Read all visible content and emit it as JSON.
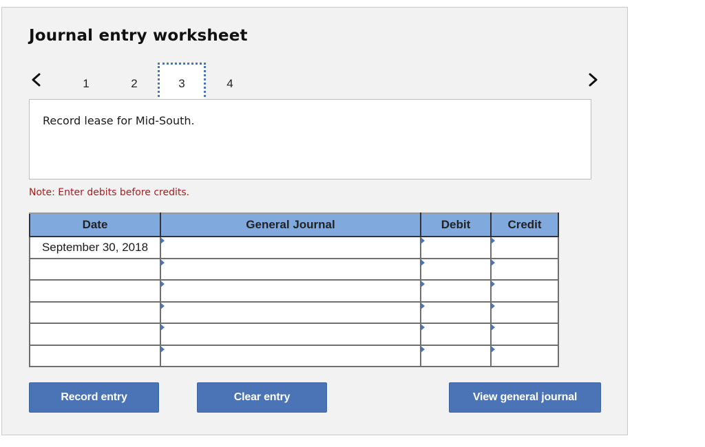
{
  "worksheet": {
    "title": "Journal entry worksheet",
    "nav": {
      "prev_icon": "chevron-left-icon",
      "next_icon": "chevron-right-icon",
      "steps": [
        "1",
        "2",
        "3",
        "4"
      ],
      "active_step": "3"
    },
    "description": "Record lease for Mid-South.",
    "note": "Note: Enter debits before credits.",
    "note_color": "#a51d1d",
    "accent_color": "#4a74b5",
    "header_color": "#80a9dd"
  },
  "journal": {
    "columns": [
      "Date",
      "General Journal",
      "Debit",
      "Credit"
    ],
    "rows": [
      {
        "date": "September 30, 2018",
        "account": "",
        "debit": "",
        "credit": ""
      },
      {
        "date": "",
        "account": "",
        "debit": "",
        "credit": ""
      },
      {
        "date": "",
        "account": "",
        "debit": "",
        "credit": ""
      },
      {
        "date": "",
        "account": "",
        "debit": "",
        "credit": ""
      },
      {
        "date": "",
        "account": "",
        "debit": "",
        "credit": ""
      },
      {
        "date": "",
        "account": "",
        "debit": "",
        "credit": ""
      }
    ]
  },
  "buttons": {
    "record": "Record entry",
    "clear": "Clear entry",
    "view": "View general journal"
  }
}
